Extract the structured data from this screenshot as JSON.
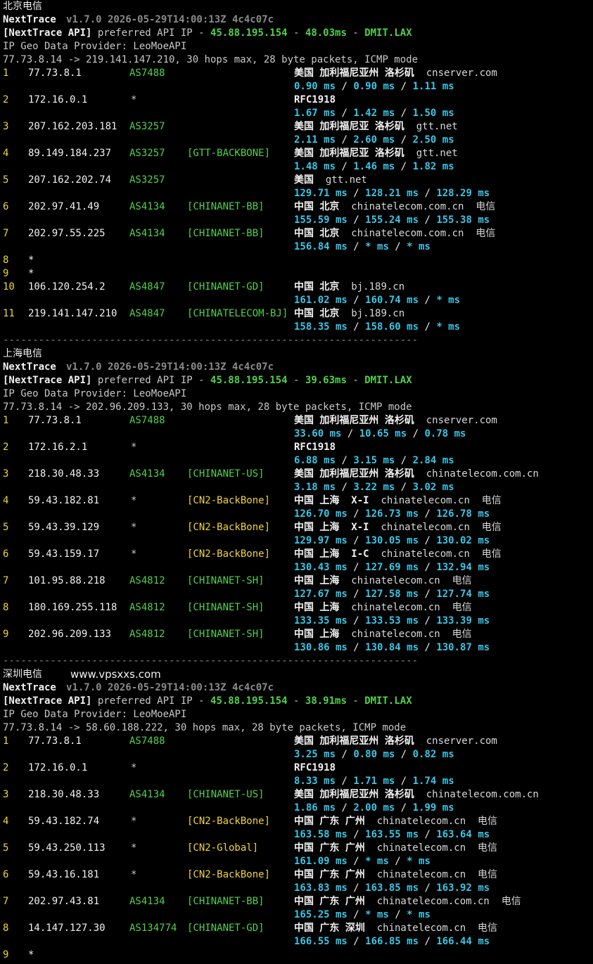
{
  "colors": {
    "background": "#000000",
    "green": "#52d14b",
    "cyan": "#39c6e6",
    "yellow": "#f0d43a"
  },
  "sections": [
    {
      "title": "北京电信",
      "watermark": "",
      "app_name": "NextTrace",
      "version_line": "v1.7.0 2026-05-29T14:00:13Z 4c4c07c",
      "api_tag": "[NextTrace API]",
      "api_text": " preferred API IP - ",
      "api_ip": "45.88.195.154",
      "api_dash": " - ",
      "api_latency": "48.03ms",
      "api_dash2": " - ",
      "api_node": "DMIT.LAX",
      "geo_provider": "IP Geo Data Provider: LeoMoeAPI",
      "trace_header": "77.73.8.14 -> 219.141.147.210, 30 hops max, 28 byte packets, ICMP mode",
      "hops": [
        {
          "n": "1",
          "ip": "77.73.8.1",
          "asn": "AS7488",
          "tag": "",
          "geo": "美国 加利福尼亚州 洛杉矶",
          "host": "cnserver.com",
          "isp": "",
          "rtt": [
            "0.90 ms",
            "0.90 ms",
            "1.11 ms"
          ]
        },
        {
          "n": "2",
          "ip": "172.16.0.1",
          "asn": "*",
          "tag": "",
          "geo": "RFC1918",
          "host": "",
          "isp": "",
          "rtt": [
            "1.67 ms",
            "1.42 ms",
            "1.50 ms"
          ]
        },
        {
          "n": "3",
          "ip": "207.162.203.181",
          "asn": "AS3257",
          "tag": "",
          "geo": "美国 加利福尼亚 洛杉矶",
          "host": "gtt.net",
          "isp": "",
          "rtt": [
            "2.11 ms",
            "2.60 ms",
            "2.50 ms"
          ]
        },
        {
          "n": "4",
          "ip": "89.149.184.237",
          "asn": "AS3257",
          "tag": "[GTT-BACKBONE]",
          "geo": "美国 加利福尼亚 洛杉矶",
          "host": "gtt.net",
          "isp": "",
          "rtt": [
            "1.48 ms",
            "1.46 ms",
            "1.82 ms"
          ]
        },
        {
          "n": "5",
          "ip": "207.162.202.74",
          "asn": "AS3257",
          "tag": "",
          "geo": "美国",
          "host": "gtt.net",
          "isp": "",
          "rtt": [
            "129.71 ms",
            "128.21 ms",
            "128.29 ms"
          ]
        },
        {
          "n": "6",
          "ip": "202.97.41.49",
          "asn": "AS4134",
          "tag": "[CHINANET-BB]",
          "geo": "中国 北京",
          "host": "chinatelecom.com.cn",
          "isp": "电信",
          "rtt": [
            "155.59 ms",
            "155.24 ms",
            "155.38 ms"
          ]
        },
        {
          "n": "7",
          "ip": "202.97.55.225",
          "asn": "AS4134",
          "tag": "[CHINANET-BB]",
          "geo": "中国 北京",
          "host": "chinatelecom.com.cn",
          "isp": "电信",
          "rtt": [
            "156.84 ms",
            "* ms",
            "* ms"
          ]
        },
        {
          "n": "8",
          "ip": "*",
          "asn": "",
          "tag": "",
          "geo": "",
          "host": "",
          "isp": "",
          "rtt": []
        },
        {
          "n": "9",
          "ip": "*",
          "asn": "",
          "tag": "",
          "geo": "",
          "host": "",
          "isp": "",
          "rtt": []
        },
        {
          "n": "10",
          "ip": "106.120.254.2",
          "asn": "AS4847",
          "tag": "[CHINANET-GD]",
          "geo": "中国 北京",
          "host": "bj.189.cn",
          "isp": "",
          "rtt": [
            "161.02 ms",
            "160.74 ms",
            "* ms"
          ]
        },
        {
          "n": "11",
          "ip": "219.141.147.210",
          "asn": "AS4847",
          "tag": "[CHINATELECOM-BJ]",
          "geo": "中国 北京",
          "host": "bj.189.cn",
          "isp": "",
          "rtt": [
            "158.35 ms",
            "158.60 ms",
            "* ms"
          ]
        }
      ],
      "separator": "----------------------------------------------------------------------"
    },
    {
      "title": "上海电信",
      "watermark": "",
      "app_name": "NextTrace",
      "version_line": "v1.7.0 2026-05-29T14:00:13Z 4c4c07c",
      "api_tag": "[NextTrace API]",
      "api_text": " preferred API IP - ",
      "api_ip": "45.88.195.154",
      "api_dash": " - ",
      "api_latency": "39.63ms",
      "api_dash2": " - ",
      "api_node": "DMIT.LAX",
      "geo_provider": "IP Geo Data Provider: LeoMoeAPI",
      "trace_header": "77.73.8.14 -> 202.96.209.133, 30 hops max, 28 byte packets, ICMP mode",
      "hops": [
        {
          "n": "1",
          "ip": "77.73.8.1",
          "asn": "AS7488",
          "tag": "",
          "geo": "美国 加利福尼亚州 洛杉矶",
          "host": "cnserver.com",
          "isp": "",
          "rtt": [
            "33.60 ms",
            "10.65 ms",
            "0.78 ms"
          ]
        },
        {
          "n": "2",
          "ip": "172.16.2.1",
          "asn": "*",
          "tag": "",
          "geo": "RFC1918",
          "host": "",
          "isp": "",
          "rtt": [
            "6.88 ms",
            "3.15 ms",
            "2.84 ms"
          ]
        },
        {
          "n": "3",
          "ip": "218.30.48.33",
          "asn": "AS4134",
          "tag": "[CHINANET-US]",
          "geo": "美国 加利福尼亚州 洛杉矶",
          "host": "chinatelecom.com.cn",
          "isp": "",
          "rtt": [
            "3.18 ms",
            "3.22 ms",
            "3.02 ms"
          ]
        },
        {
          "n": "4",
          "ip": "59.43.182.81",
          "asn": "*",
          "tag": "[CN2-BackBone]",
          "geo": "中国 上海  X-I",
          "host": "chinatelecom.cn",
          "isp": "电信",
          "rtt": [
            "126.70 ms",
            "126.73 ms",
            "126.78 ms"
          ]
        },
        {
          "n": "5",
          "ip": "59.43.39.129",
          "asn": "*",
          "tag": "[CN2-BackBone]",
          "geo": "中国 上海  X-I",
          "host": "chinatelecom.cn",
          "isp": "电信",
          "rtt": [
            "129.97 ms",
            "130.05 ms",
            "130.02 ms"
          ]
        },
        {
          "n": "6",
          "ip": "59.43.159.17",
          "asn": "*",
          "tag": "[CN2-BackBone]",
          "geo": "中国 上海  I-C",
          "host": "chinatelecom.cn",
          "isp": "电信",
          "rtt": [
            "130.43 ms",
            "127.69 ms",
            "132.94 ms"
          ]
        },
        {
          "n": "7",
          "ip": "101.95.88.218",
          "asn": "AS4812",
          "tag": "[CHINANET-SH]",
          "geo": "中国 上海",
          "host": "chinatelecom.cn",
          "isp": "电信",
          "rtt": [
            "127.67 ms",
            "127.58 ms",
            "127.74 ms"
          ]
        },
        {
          "n": "8",
          "ip": "180.169.255.118",
          "asn": "AS4812",
          "tag": "[CHINANET-SH]",
          "geo": "中国 上海",
          "host": "chinatelecom.cn",
          "isp": "电信",
          "rtt": [
            "133.35 ms",
            "133.53 ms",
            "133.39 ms"
          ]
        },
        {
          "n": "9",
          "ip": "202.96.209.133",
          "asn": "AS4812",
          "tag": "[CHINANET-SH]",
          "geo": "中国 上海",
          "host": "chinatelecom.cn",
          "isp": "电信",
          "rtt": [
            "130.86 ms",
            "130.84 ms",
            "130.87 ms"
          ]
        }
      ],
      "separator": "----------------------------------------------------------------------"
    },
    {
      "title": "深圳电信",
      "watermark": "www.vpsxxs.com",
      "app_name": "NextTrace",
      "version_line": "v1.7.0 2026-05-29T14:00:13Z 4c4c07c",
      "api_tag": "[NextTrace API]",
      "api_text": " preferred API IP - ",
      "api_ip": "45.88.195.154",
      "api_dash": " - ",
      "api_latency": "38.91ms",
      "api_dash2": " - ",
      "api_node": "DMIT.LAX",
      "geo_provider": "IP Geo Data Provider: LeoMoeAPI",
      "trace_header": "77.73.8.14 -> 58.60.188.222, 30 hops max, 28 byte packets, ICMP mode",
      "hops": [
        {
          "n": "1",
          "ip": "77.73.8.1",
          "asn": "AS7488",
          "tag": "",
          "geo": "美国 加利福尼亚州 洛杉矶",
          "host": "cnserver.com",
          "isp": "",
          "rtt": [
            "3.25 ms",
            "0.80 ms",
            "0.82 ms"
          ]
        },
        {
          "n": "2",
          "ip": "172.16.0.1",
          "asn": "*",
          "tag": "",
          "geo": "RFC1918",
          "host": "",
          "isp": "",
          "rtt": [
            "8.33 ms",
            "1.71 ms",
            "1.74 ms"
          ]
        },
        {
          "n": "3",
          "ip": "218.30.48.33",
          "asn": "AS4134",
          "tag": "[CHINANET-US]",
          "geo": "美国 加利福尼亚州 洛杉矶",
          "host": "chinatelecom.com.cn",
          "isp": "",
          "rtt": [
            "1.86 ms",
            "2.00 ms",
            "1.99 ms"
          ]
        },
        {
          "n": "4",
          "ip": "59.43.182.74",
          "asn": "*",
          "tag": "[CN2-BackBone]",
          "geo": "中国 广东 广州",
          "host": "chinatelecom.cn",
          "isp": "电信",
          "rtt": [
            "163.58 ms",
            "163.55 ms",
            "163.64 ms"
          ]
        },
        {
          "n": "5",
          "ip": "59.43.250.113",
          "asn": "*",
          "tag": "[CN2-Global]",
          "geo": "中国 广东 广州",
          "host": "chinatelecom.cn",
          "isp": "电信",
          "rtt": [
            "161.09 ms",
            "* ms",
            "* ms"
          ]
        },
        {
          "n": "6",
          "ip": "59.43.16.181",
          "asn": "*",
          "tag": "[CN2-BackBone]",
          "geo": "中国 广东 广州",
          "host": "chinatelecom.cn",
          "isp": "电信",
          "rtt": [
            "163.83 ms",
            "163.85 ms",
            "163.92 ms"
          ]
        },
        {
          "n": "7",
          "ip": "202.97.43.81",
          "asn": "AS4134",
          "tag": "[CHINANET-BB]",
          "geo": "中国 广东 广州",
          "host": "chinatelecom.com.cn",
          "isp": "电信",
          "rtt": [
            "165.25 ms",
            "* ms",
            "* ms"
          ]
        },
        {
          "n": "8",
          "ip": "14.147.127.30",
          "asn": "AS134774",
          "tag": "[CHINANET-GD]",
          "geo": "中国 广东 深圳",
          "host": "chinatelecom.cn",
          "isp": "电信",
          "rtt": [
            "166.55 ms",
            "166.85 ms",
            "166.44 ms"
          ]
        },
        {
          "n": "9",
          "ip": "*",
          "asn": "",
          "tag": "",
          "geo": "",
          "host": "",
          "isp": "",
          "rtt": []
        }
      ],
      "separator": ""
    }
  ]
}
